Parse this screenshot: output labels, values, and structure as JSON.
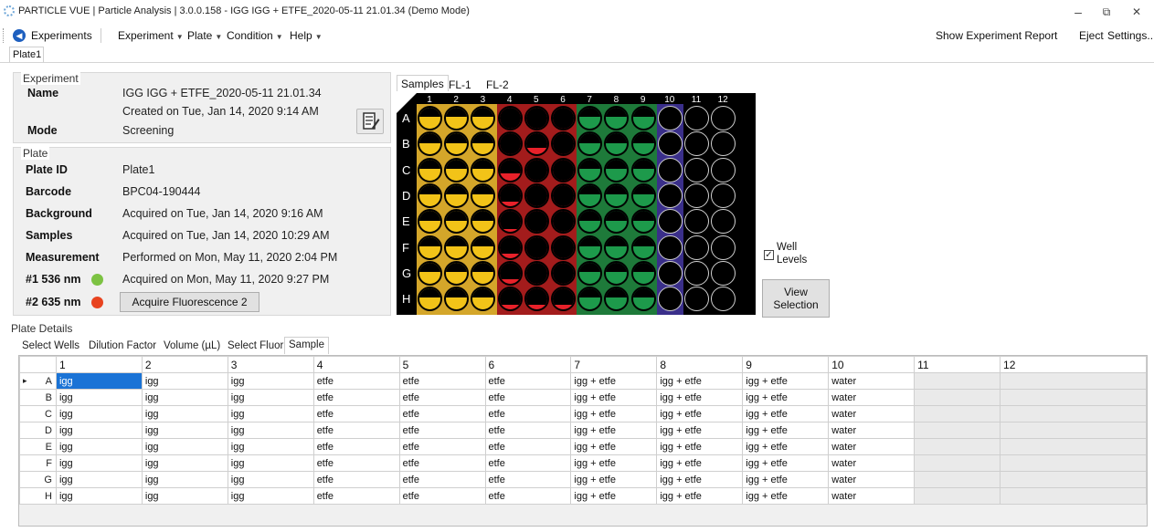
{
  "window": {
    "title": "PARTICLE VUE | Particle Analysis | 3.0.0.158 - IGG IGG + ETFE_2020-05-11 21.01.34 (Demo Mode)",
    "minimize": "–",
    "restore": "⧉",
    "close": "✕"
  },
  "menu": {
    "experiments": "Experiments",
    "experiment": "Experiment",
    "plate": "Plate",
    "condition": "Condition",
    "help": "Help",
    "show_report": "Show Experiment Report",
    "eject": "Eject",
    "settings": "Settings..."
  },
  "doc_tab": "Plate1",
  "experiment": {
    "group_title": "Experiment",
    "name_label": "Name",
    "name_value": "IGG IGG + ETFE_2020-05-11 21.01.34",
    "created": "Created on Tue, Jan 14, 2020 9:14 AM",
    "mode_label": "Mode",
    "mode_value": "Screening"
  },
  "plate": {
    "group_title": "Plate",
    "rows": [
      {
        "label": "Plate ID",
        "value": "Plate1"
      },
      {
        "label": "Barcode",
        "value": "BPC04-190444"
      },
      {
        "label": "Background",
        "value": "Acquired on Tue, Jan 14, 2020 9:16 AM"
      },
      {
        "label": "Samples",
        "value": "Acquired on Tue, Jan 14, 2020 10:29 AM"
      },
      {
        "label": "Measurement",
        "value": "Performed on Mon, May 11, 2020 2:04 PM"
      },
      {
        "label": "#1 536 nm",
        "value": "Acquired on Mon, May 11, 2020 9:27 PM"
      },
      {
        "label": "#2 635 nm",
        "value": ""
      }
    ],
    "fl1_color": "#7cc242",
    "fl2_color": "#e8431f",
    "acquire_button": "Acquire Fluorescence 2"
  },
  "plate_view": {
    "tabs": [
      "Samples",
      "FL-1",
      "FL-2"
    ],
    "columns": [
      "1",
      "2",
      "3",
      "4",
      "5",
      "6",
      "7",
      "8",
      "9",
      "10",
      "11",
      "12"
    ],
    "rows": [
      "A",
      "B",
      "C",
      "D",
      "E",
      "F",
      "G",
      "H"
    ],
    "band_colors": [
      "#d4a62a",
      "#d4a62a",
      "#d4a62a",
      "#a31c1c",
      "#a31c1c",
      "#a31c1c",
      "#1e7a3a",
      "#1e7a3a",
      "#1e7a3a",
      "#3a2f8a",
      "#000000",
      "#000000"
    ],
    "fill_colors": [
      "#f2c318",
      "#f2c318",
      "#f2c318",
      "#e8212a",
      "#e8212a",
      "#e8212a",
      "#1d9a4b",
      "#1d9a4b",
      "#1d9a4b",
      "#000000",
      "#000000",
      "#000000"
    ],
    "fill_levels": [
      [
        0.55,
        0.55,
        0.55,
        0.0,
        0.0,
        0.0,
        0.55,
        0.55,
        0.55,
        0,
        0,
        0
      ],
      [
        0.55,
        0.55,
        0.55,
        0.0,
        0.3,
        0.0,
        0.55,
        0.55,
        0.55,
        0,
        0,
        0
      ],
      [
        0.55,
        0.55,
        0.55,
        0.35,
        0.0,
        0.0,
        0.55,
        0.55,
        0.55,
        0,
        0,
        0
      ],
      [
        0.55,
        0.55,
        0.55,
        0.2,
        0.0,
        0.0,
        0.55,
        0.55,
        0.55,
        0,
        0,
        0
      ],
      [
        0.55,
        0.55,
        0.55,
        0.15,
        0.0,
        0.0,
        0.55,
        0.55,
        0.55,
        0,
        0,
        0
      ],
      [
        0.55,
        0.55,
        0.55,
        0.2,
        0.0,
        0.0,
        0.55,
        0.55,
        0.55,
        0,
        0,
        0
      ],
      [
        0.55,
        0.55,
        0.55,
        0.2,
        0.0,
        0.0,
        0.55,
        0.55,
        0.55,
        0,
        0,
        0
      ],
      [
        0.55,
        0.55,
        0.55,
        0.2,
        0.2,
        0.2,
        0.55,
        0.55,
        0.55,
        0,
        0,
        0
      ]
    ],
    "well_levels_label": "Well Levels",
    "well_levels_checked": "✓",
    "view_selection": "View Selection"
  },
  "plate_details": {
    "title": "Plate Details",
    "tabs": [
      "Select Wells",
      "Dilution Factor",
      "Volume (µL)",
      "Select Fluor",
      "Sample"
    ],
    "columns": [
      "1",
      "2",
      "3",
      "4",
      "5",
      "6",
      "7",
      "8",
      "9",
      "10",
      "11",
      "12"
    ],
    "row_marker": "▸",
    "rows": [
      {
        "row": "A",
        "cells": [
          "igg",
          "igg",
          "igg",
          "etfe",
          "etfe",
          "etfe",
          "igg + etfe",
          "igg + etfe",
          "igg + etfe",
          "water",
          "",
          ""
        ]
      },
      {
        "row": "B",
        "cells": [
          "igg",
          "igg",
          "igg",
          "etfe",
          "etfe",
          "etfe",
          "igg + etfe",
          "igg + etfe",
          "igg + etfe",
          "water",
          "",
          ""
        ]
      },
      {
        "row": "C",
        "cells": [
          "igg",
          "igg",
          "igg",
          "etfe",
          "etfe",
          "etfe",
          "igg + etfe",
          "igg + etfe",
          "igg + etfe",
          "water",
          "",
          ""
        ]
      },
      {
        "row": "D",
        "cells": [
          "igg",
          "igg",
          "igg",
          "etfe",
          "etfe",
          "etfe",
          "igg + etfe",
          "igg + etfe",
          "igg + etfe",
          "water",
          "",
          ""
        ]
      },
      {
        "row": "E",
        "cells": [
          "igg",
          "igg",
          "igg",
          "etfe",
          "etfe",
          "etfe",
          "igg + etfe",
          "igg + etfe",
          "igg + etfe",
          "water",
          "",
          ""
        ]
      },
      {
        "row": "F",
        "cells": [
          "igg",
          "igg",
          "igg",
          "etfe",
          "etfe",
          "etfe",
          "igg + etfe",
          "igg + etfe",
          "igg + etfe",
          "water",
          "",
          ""
        ]
      },
      {
        "row": "G",
        "cells": [
          "igg",
          "igg",
          "igg",
          "etfe",
          "etfe",
          "etfe",
          "igg + etfe",
          "igg + etfe",
          "igg + etfe",
          "water",
          "",
          ""
        ]
      },
      {
        "row": "H",
        "cells": [
          "igg",
          "igg",
          "igg",
          "etfe",
          "etfe",
          "etfe",
          "igg + etfe",
          "igg + etfe",
          "igg + etfe",
          "water",
          "",
          ""
        ]
      }
    ]
  }
}
